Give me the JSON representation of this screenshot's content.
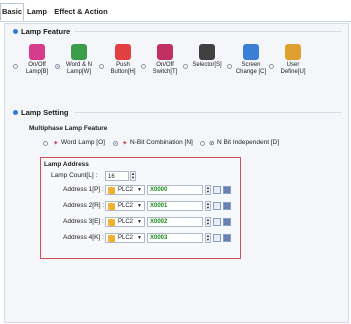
{
  "tabs": [
    "Basic",
    "Lamp",
    "Effect & Action"
  ],
  "lamp_feature": {
    "title": "Lamp Feature",
    "options": [
      {
        "line1": "On/Off",
        "line2": "Lamp[B]",
        "icon": "lamp-bulb-icon",
        "color": "#d63b8c",
        "selected": false
      },
      {
        "line1": "Word & N",
        "line2": "Lamp[W]",
        "icon": "word-lamp-icon",
        "color": "#3b9d4a",
        "selected": true
      },
      {
        "line1": "Push",
        "line2": "Button[H]",
        "icon": "push-button-icon",
        "color": "#e04040",
        "selected": false
      },
      {
        "line1": "On/Off",
        "line2": "Switch[T]",
        "icon": "switch-icon",
        "color": "#c03060",
        "selected": false
      },
      {
        "line1": "Selector[S]",
        "line2": "",
        "icon": "selector-icon",
        "color": "#404040",
        "selected": false
      },
      {
        "line1": "Screen",
        "line2": "Change [C]",
        "icon": "screen-change-icon",
        "color": "#3a7fd6",
        "selected": false
      },
      {
        "line1": "User",
        "line2": "Define[U]",
        "icon": "user-define-icon",
        "color": "#e0a030",
        "selected": false
      }
    ]
  },
  "lamp_setting": {
    "title": "Lamp Setting",
    "multiphase_label": "Multiphase Lamp Feature",
    "modes": [
      {
        "label": "Word Lamp [O]",
        "selected": false
      },
      {
        "label": "N-Bit Combination [N]",
        "selected": true
      },
      {
        "label": "N Bit Independent [D]",
        "selected": false
      }
    ]
  },
  "lamp_address": {
    "title": "Lamp Address",
    "count_label": "Lamp Count[L] :",
    "count_value": "16",
    "rows": [
      {
        "label": "Address 1[P] :",
        "plc": "PLC2",
        "value": "X0000"
      },
      {
        "label": "Address 2[R] :",
        "plc": "PLC2",
        "value": "X0001"
      },
      {
        "label": "Address 3[E] :",
        "plc": "PLC2",
        "value": "X0002"
      },
      {
        "label": "Address 4[K] :",
        "plc": "PLC2",
        "value": "X0003"
      }
    ]
  }
}
